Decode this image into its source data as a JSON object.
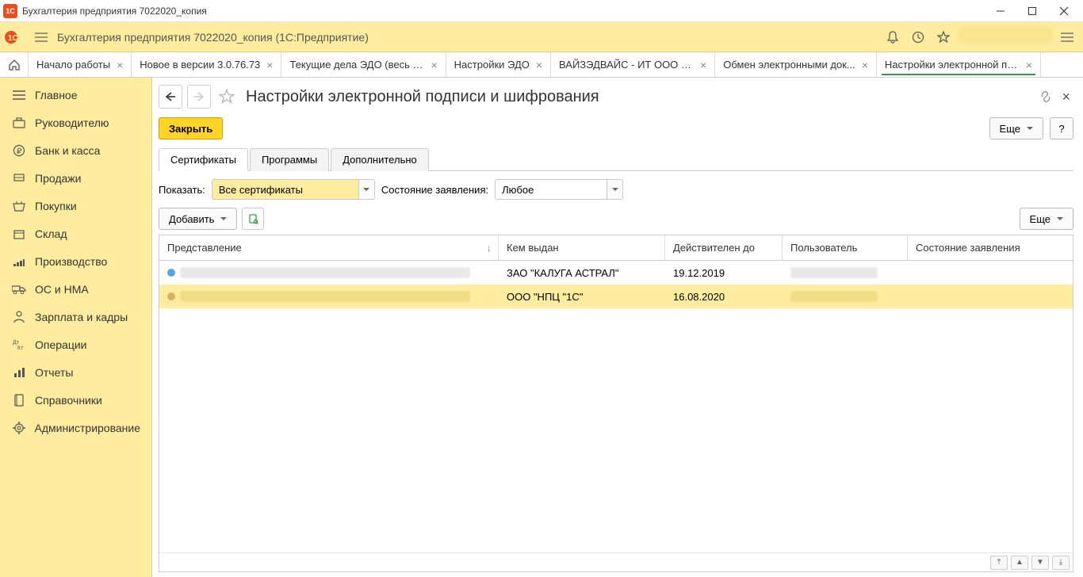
{
  "os_title": "Бухгалтерия предприятия 7022020_копия",
  "app_subtitle": "Бухгалтерия предприятия 7022020_копия  (1С:Предприятие)",
  "tabs": [
    {
      "label": "Начало работы"
    },
    {
      "label": "Новое в версии 3.0.76.73"
    },
    {
      "label": "Текущие дела ЭДО (весь д..."
    },
    {
      "label": "Настройки ЭДО"
    },
    {
      "label": "ВАЙЗЭДВАЙС - ИТ ООО (К..."
    },
    {
      "label": "Обмен электронными док..."
    },
    {
      "label": "Настройки электронной под...",
      "active": true
    }
  ],
  "sidebar": [
    {
      "label": "Главное",
      "icon": "menu"
    },
    {
      "label": "Руководителю",
      "icon": "briefcase"
    },
    {
      "label": "Банк и касса",
      "icon": "coin"
    },
    {
      "label": "Продажи",
      "icon": "cart"
    },
    {
      "label": "Покупки",
      "icon": "basket"
    },
    {
      "label": "Склад",
      "icon": "box"
    },
    {
      "label": "Производство",
      "icon": "factory"
    },
    {
      "label": "ОС и НМА",
      "icon": "truck"
    },
    {
      "label": "Зарплата и кадры",
      "icon": "person"
    },
    {
      "label": "Операции",
      "icon": "ops"
    },
    {
      "label": "Отчеты",
      "icon": "chart"
    },
    {
      "label": "Справочники",
      "icon": "book"
    },
    {
      "label": "Администрирование",
      "icon": "gear"
    }
  ],
  "page": {
    "title": "Настройки электронной подписи и шифрования",
    "close_btn": "Закрыть",
    "more_btn": "Еще",
    "help_btn": "?",
    "subtabs": [
      "Сертификаты",
      "Программы",
      "Дополнительно"
    ],
    "filter": {
      "show_label": "Показать:",
      "show_value": "Все сертификаты",
      "state_label": "Состояние заявления:",
      "state_value": "Любое"
    },
    "toolbar": {
      "add_btn": "Добавить",
      "more_btn": "Еще"
    },
    "columns": {
      "presentation": "Представление",
      "issuer": "Кем выдан",
      "valid_until": "Действителен до",
      "user": "Пользователь",
      "app_state": "Состояние заявления"
    },
    "rows": [
      {
        "issuer": "ЗАО \"КАЛУГА АСТРАЛ\"",
        "valid": "19.12.2019",
        "selected": false
      },
      {
        "issuer": "ООО \"НПЦ \"1С\"",
        "valid": "16.08.2020",
        "selected": true
      }
    ]
  }
}
